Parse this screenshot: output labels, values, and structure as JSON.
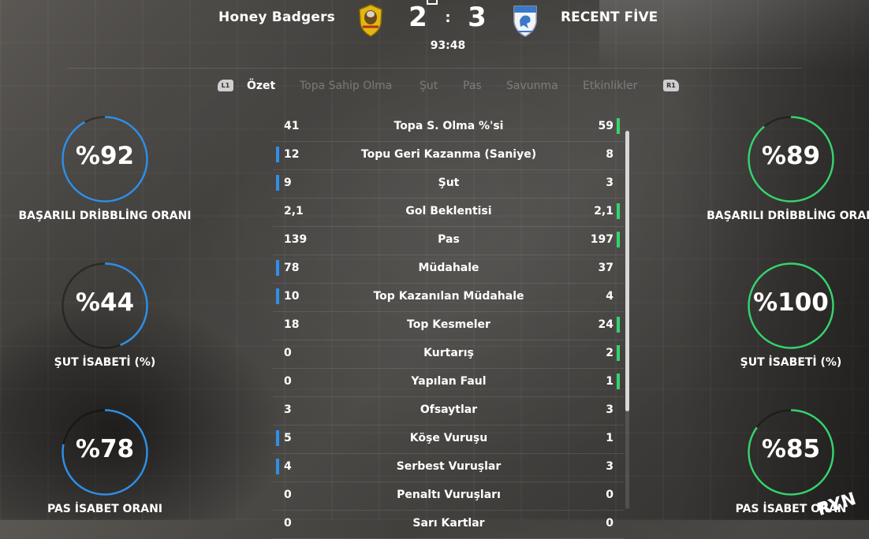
{
  "header": {
    "home_team": "Honey Badgers",
    "away_team": "RECENT FİVE",
    "home_score": "2",
    "separator": ":",
    "away_score": "3",
    "clock": "93:48"
  },
  "tabs": {
    "left_bumper": "L1",
    "right_bumper": "R1",
    "items": [
      "Özet",
      "Topa Sahip Olma",
      "Şut",
      "Pas",
      "Savunma",
      "Etkinlikler"
    ],
    "active_index": 0
  },
  "home_rings": [
    {
      "value_text": "%92",
      "value": 92,
      "label": "BAŞARILI DRİBBLİNG ORANI"
    },
    {
      "value_text": "%44",
      "value": 44,
      "label": "ŞUT İSABETİ (%)"
    },
    {
      "value_text": "%78",
      "value": 78,
      "label": "PAS İSABET ORANI"
    }
  ],
  "away_rings": [
    {
      "value_text": "%89",
      "value": 89,
      "label": "BAŞARILI DRİBBLİNG ORAN"
    },
    {
      "value_text": "%100",
      "value": 100,
      "label": "ŞUT İSABETİ (%)"
    },
    {
      "value_text": "%85",
      "value": 85,
      "label": "PAS İSABET ORAN"
    }
  ],
  "stats": [
    {
      "name": "Topa S. Olma %'si",
      "home": "41",
      "away": "59",
      "leader": "away"
    },
    {
      "name": "Topu Geri Kazanma (Saniye)",
      "home": "12",
      "away": "8",
      "leader": "home"
    },
    {
      "name": "Şut",
      "home": "9",
      "away": "3",
      "leader": "home"
    },
    {
      "name": "Gol Beklentisi",
      "home": "2,1",
      "away": "2,1",
      "leader": "away"
    },
    {
      "name": "Pas",
      "home": "139",
      "away": "197",
      "leader": "away"
    },
    {
      "name": "Müdahale",
      "home": "78",
      "away": "37",
      "leader": "home"
    },
    {
      "name": "Top Kazanılan Müdahale",
      "home": "10",
      "away": "4",
      "leader": "home"
    },
    {
      "name": "Top Kesmeler",
      "home": "18",
      "away": "24",
      "leader": "away"
    },
    {
      "name": "Kurtarış",
      "home": "0",
      "away": "2",
      "leader": "away"
    },
    {
      "name": "Yapılan Faul",
      "home": "0",
      "away": "1",
      "leader": "away"
    },
    {
      "name": "Ofsaytlar",
      "home": "3",
      "away": "3",
      "leader": "none"
    },
    {
      "name": "Köşe Vuruşu",
      "home": "5",
      "away": "1",
      "leader": "home"
    },
    {
      "name": "Serbest Vuruşlar",
      "home": "4",
      "away": "3",
      "leader": "home"
    },
    {
      "name": "Penaltı Vuruşları",
      "home": "0",
      "away": "0",
      "leader": "none"
    },
    {
      "name": "Sarı Kartlar",
      "home": "0",
      "away": "0",
      "leader": "none"
    }
  ],
  "colors": {
    "home_accent": "#2f8fe8",
    "away_accent": "#35d36e"
  },
  "corner_text": "RYN"
}
